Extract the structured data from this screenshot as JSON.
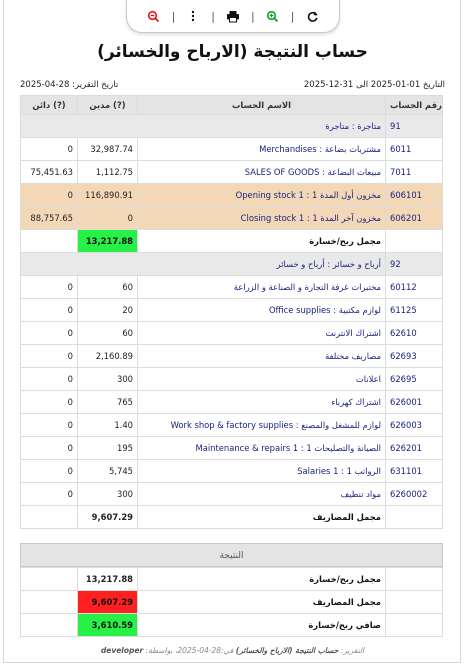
{
  "toolbar": {
    "items": [
      "refresh-icon",
      "zoom-in-icon",
      "print-icon",
      "more-icon",
      "zoom-out-icon"
    ]
  },
  "title": "حساب النتيجة (الارباح والخسائر)",
  "period": "التاريخ 01-01-2025 الى 31-12-2025",
  "report_date": "تاريخ التقرير: 28-04-2025",
  "columns": {
    "account_no": "رقم الحساب",
    "account_name": "الاسم الحساب",
    "debit": "مدين (?)",
    "credit": "دائن (?)"
  },
  "rows": [
    {
      "type": "group",
      "code": "91",
      "name": "متاجرة : متاجرة"
    },
    {
      "type": "row",
      "code": "6011",
      "name": "مشتريات بضاعة : Merchandises",
      "debit": "32,987.74",
      "credit": "0"
    },
    {
      "type": "row",
      "code": "7011",
      "name": "مبيعات البضاعة : SALES OF GOODS",
      "debit": "1,112.75",
      "credit": "75,451.63"
    },
    {
      "type": "opening",
      "code": "606101",
      "name": "مخزون أول المدة 1 : Opening stock 1",
      "debit": "116,890.91",
      "credit": "0"
    },
    {
      "type": "opening",
      "code": "606201",
      "name": "مخزون آخر المدة 1 : Closing stock 1",
      "debit": "0",
      "credit": "88,757.65"
    },
    {
      "type": "total",
      "label": "مجمل ربح/خسارة",
      "debit": "13,217.88",
      "highlight": "green"
    },
    {
      "type": "group",
      "code": "92",
      "name": "أرباح و خسائر : أرباح و خسائر"
    },
    {
      "type": "row",
      "code": "60112",
      "name": "مختبرات غرفة التجارة و الصناعة و الزراعة",
      "debit": "60",
      "credit": "0"
    },
    {
      "type": "row",
      "code": "61125",
      "name": "لوازم مكتبية : Office supplies",
      "debit": "20",
      "credit": "0"
    },
    {
      "type": "row",
      "code": "62610",
      "name": "اشتراك الانترنت",
      "debit": "60",
      "credit": "0"
    },
    {
      "type": "row",
      "code": "62693",
      "name": "مصاريف مختلفة",
      "debit": "2,160.89",
      "credit": "0"
    },
    {
      "type": "row",
      "code": "62695",
      "name": "اعلانات",
      "debit": "300",
      "credit": "0"
    },
    {
      "type": "row",
      "code": "626001",
      "name": "اشتراك كهرباء",
      "debit": "765",
      "credit": "0"
    },
    {
      "type": "row",
      "code": "626003",
      "name": "لوازم للمشغل والمصنع : Work shop & factory supplies",
      "debit": "1.40",
      "credit": "0"
    },
    {
      "type": "row",
      "code": "626201",
      "name": "الصيانة والتصليحات 1 : Maintenance & repairs 1",
      "debit": "195",
      "credit": "0"
    },
    {
      "type": "row",
      "code": "631101",
      "name": "الرواتب 1 : Salaries 1",
      "debit": "5,745",
      "credit": "0"
    },
    {
      "type": "row",
      "code": "6260002",
      "name": "مواد تنظيف",
      "debit": "300",
      "credit": "0"
    },
    {
      "type": "total",
      "label": "مجمل المصاريف",
      "debit": "9,607.29",
      "highlight": "none"
    }
  ],
  "result": {
    "heading": "النتيجة",
    "rows": [
      {
        "label": "مجمل ربح/خسارة",
        "value": "13,217.88",
        "highlight": "none"
      },
      {
        "label": "مجمل المصاريف",
        "value": "9,607.29",
        "highlight": "red"
      },
      {
        "label": "صافي ربح/خسارة",
        "value": "3,610.59",
        "highlight": "green"
      }
    ]
  },
  "footer": {
    "prefix": "التقرير:",
    "report_name": "حساب النتيجة (الارباح والخسائر)",
    "date_part": "في:28-04-2025، بواسطة:",
    "user": "developer"
  },
  "colors": {
    "green": "#27f046",
    "red": "#ff2020",
    "opening": "#f3d8b8",
    "link": "#1a237e"
  }
}
